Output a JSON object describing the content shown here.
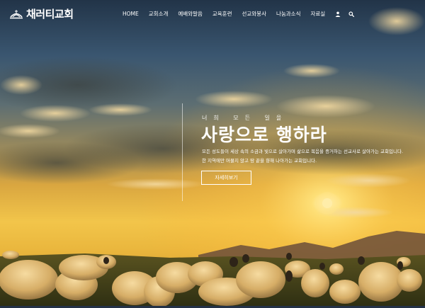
{
  "brand": {
    "name": "채러티교회"
  },
  "nav": {
    "items": [
      "HOME",
      "교회소개",
      "예배와말씀",
      "교육훈련",
      "선교와봉사",
      "나눔과소식",
      "자료실"
    ],
    "icons": [
      "user-icon",
      "search-icon"
    ]
  },
  "hero": {
    "eyebrow": "너희 모든 일을",
    "title": "사랑으로 행하라",
    "description": [
      "모든 성도들이 세상 속의 소금과 빛으로 살아가며 삶으로 복음을 증거하는 선교사로 살아가는 교회입니다.",
      "한 지역에만 머물지 않고 땅 끝을 향해 나아가는 교회입니다."
    ],
    "button_label": "자세히보기"
  },
  "colors": {
    "text": "#ffffff",
    "sky_top": "#26394f",
    "sun": "#ffd34d",
    "footer_bar": "#243247"
  }
}
